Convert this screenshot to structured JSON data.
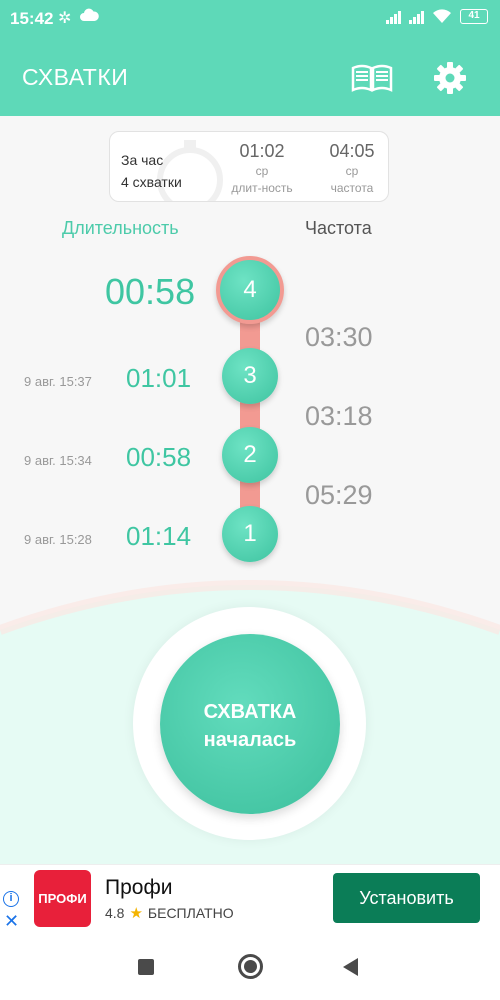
{
  "status_bar": {
    "time": "15:42",
    "battery": "41"
  },
  "app_bar": {
    "title": "СХВАТКИ"
  },
  "summary": {
    "per_hour_label": "За час",
    "per_hour_count": "4 схватки",
    "avg_duration": {
      "value": "01:02",
      "label_1": "ср",
      "label_2": "длит-ность"
    },
    "avg_frequency": {
      "value": "04:05",
      "label_1": "ср",
      "label_2": "частота"
    }
  },
  "columns": {
    "duration": "Длительность",
    "frequency": "Частота"
  },
  "contractions": [
    {
      "number": "4",
      "duration": "00:58",
      "timestamp": ""
    },
    {
      "number": "3",
      "duration": "01:01",
      "timestamp": "9 авг. 15:37"
    },
    {
      "number": "2",
      "duration": "00:58",
      "timestamp": "9 авг. 15:34"
    },
    {
      "number": "1",
      "duration": "01:14",
      "timestamp": "9 авг. 15:28"
    }
  ],
  "intervals": [
    "03:30",
    "03:18",
    "05:29"
  ],
  "start_button": {
    "line1": "СХВАТКА",
    "line2": "началась"
  },
  "ad": {
    "logo_text": "ПРОФИ",
    "title": "Профи",
    "rating": "4.8",
    "price": "БЕСПЛАТНО",
    "install_label": "Установить",
    "info_icon": "i",
    "close_icon": "✕"
  },
  "colors": {
    "accent": "#5ed9b8",
    "connector": "#f29a92",
    "install": "#0b7d57",
    "ad_logo": "#e8203a"
  }
}
